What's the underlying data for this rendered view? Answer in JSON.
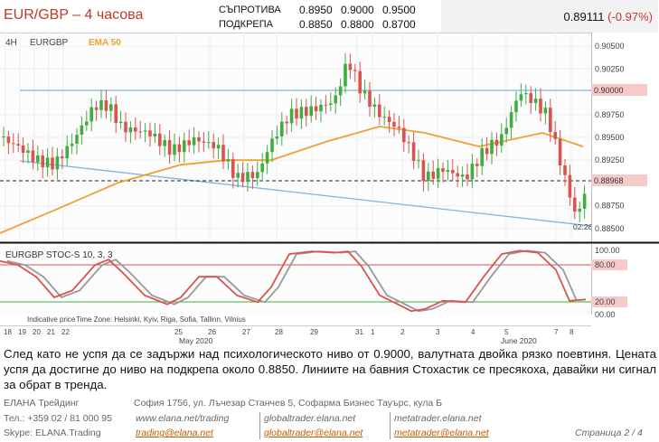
{
  "header": {
    "title": "EUR/GBP – 4 часова",
    "resistance_label": "СЪПРОТИВА",
    "support_label": "ПОДКРЕПА",
    "resistance_levels": [
      "0.8950",
      "0.9000",
      "0.9500"
    ],
    "support_levels": [
      "0.8850",
      "0.8800",
      "0.8700"
    ],
    "price": "0.89111",
    "change": "(-0.97%)"
  },
  "chart": {
    "timeframe": "4H",
    "symbol": "EURGBP",
    "ema_label": "EMA 50",
    "stoch_label": "EURGBP  STOC-S 10, 3, 3",
    "indicative": "Indicative price",
    "timezone": "Time Zone: Helsinki, Kyiv, Riga, Sofia, Tallinn, Vilnius",
    "time_label": "02:26:05",
    "price_ticks": [
      "0.90500",
      "0.90250",
      "0.90000",
      "0.89750",
      "0.89500",
      "0.89250",
      "0.88968",
      "0.88750",
      "0.88500"
    ],
    "stoch_ticks": [
      "100.00",
      "80.00",
      "20.00",
      "00.00"
    ],
    "date_ticks": [
      "18",
      "19",
      "20",
      "21",
      "22",
      "25",
      "26",
      "27",
      "28",
      "29",
      "31",
      "1",
      "2",
      "3",
      "4",
      "5",
      "7",
      "8"
    ],
    "month_labels": [
      "May 2020",
      "June 2020"
    ],
    "colors": {
      "up": "#3fae3f",
      "down": "#d9534f",
      "ema": "#f0a030",
      "trend": "#7fb6dd",
      "stoch_k": "#d9534f",
      "stoch_d": "#999999"
    }
  },
  "chart_data": {
    "type": "candlestick",
    "y_ticks": [
      0.905,
      0.9025,
      0.9,
      0.8975,
      0.895,
      0.8925,
      0.8897,
      0.8875,
      0.885
    ],
    "ylim": [
      0.8835,
      0.9065
    ],
    "current_price": 0.88968,
    "highlighted_level": 0.9,
    "ema_label": "EMA 50",
    "stochastic": {
      "label": "STOC-S 10, 3, 3",
      "levels": [
        80,
        20
      ],
      "ylim": [
        0,
        100
      ]
    }
  },
  "body": {
    "text": "След като не успя да се задържи над психологическото ниво от 0.9000, валутната двойка рязко поевтиня. Цената успя да достигне до ниво на подкрепа около 0.8850. Линиите на бавния Стохастик се пресякоха, давайки ни сигнал за обрат в тренда."
  },
  "footer": {
    "company": "ЕЛАНА Трейдинг",
    "phone": "Тел.: +359 02 / 81 000 95",
    "skype": "Skype: ELANA.Trading",
    "address": "София 1756, ул. Лъчезар Станчев 5, Софарма Бизнес Тауърс, кула Б",
    "site1": "www.elana.net/trading",
    "email1": "trading@elana.net",
    "site2": "globaltrader.elana.net",
    "email2": "globaltrader@elana.net",
    "site3": "metatrader.elana.net",
    "email3": "metatrader@elana.net",
    "page": "Страница  2 / 4"
  }
}
